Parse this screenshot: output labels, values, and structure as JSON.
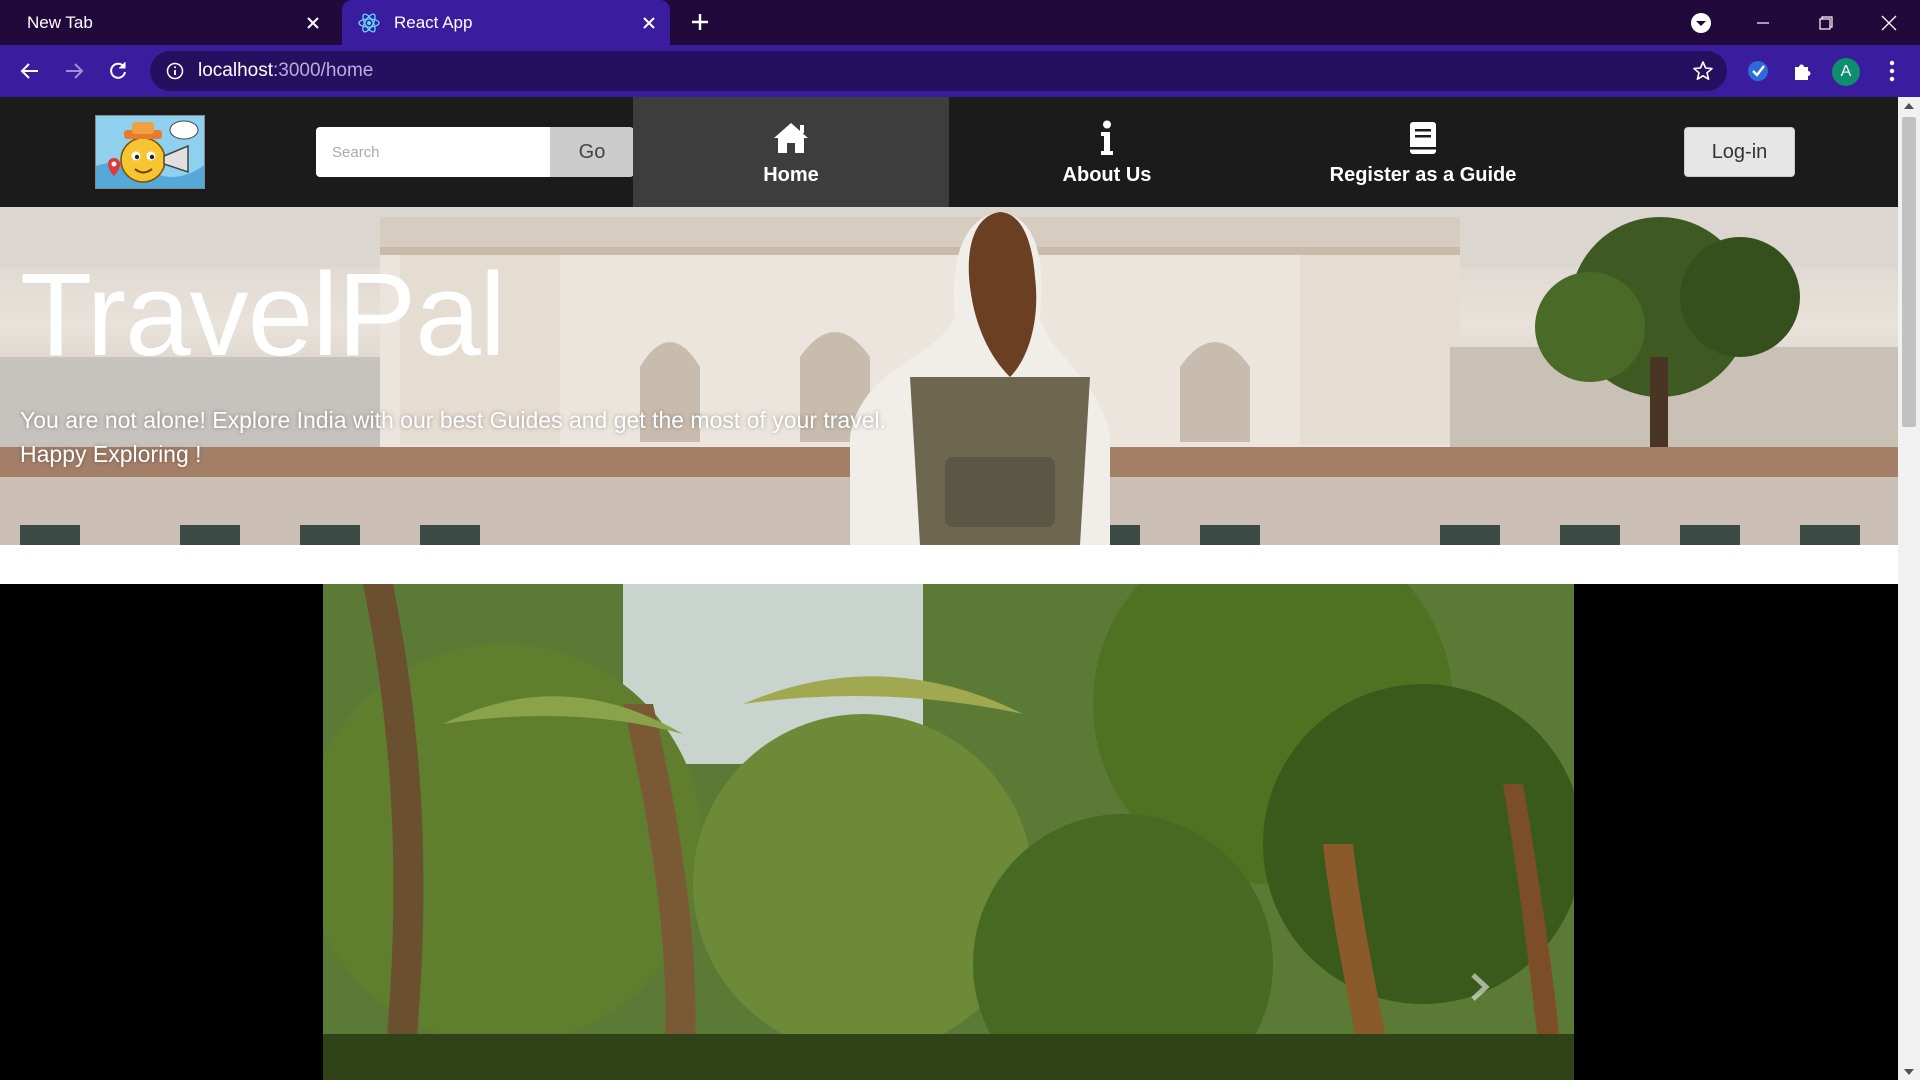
{
  "browser": {
    "tabs": [
      {
        "title": "New Tab",
        "active": false
      },
      {
        "title": "React App",
        "active": true
      }
    ],
    "address": {
      "host": "localhost",
      "path": ":3000/home"
    },
    "profile_initial": "A",
    "colors": {
      "tabbar": "#22093b",
      "toolbar": "#3a1d9e"
    }
  },
  "navbar": {
    "search_placeholder": "Search",
    "go_label": "Go",
    "items": [
      {
        "label": "Home",
        "icon": "home-icon",
        "active": true
      },
      {
        "label": "About Us",
        "icon": "info-icon",
        "active": false
      },
      {
        "label": "Register as a Guide",
        "icon": "book-icon",
        "active": false
      }
    ],
    "login_label": "Log-in"
  },
  "hero": {
    "title": "TravelPal",
    "subtitle_line1": "You are not alone! Explore India with our best Guides and get the most of your travel.",
    "subtitle_line2": "Happy Exploring !"
  },
  "carousel": {
    "next_icon": "chevron-right-icon"
  }
}
